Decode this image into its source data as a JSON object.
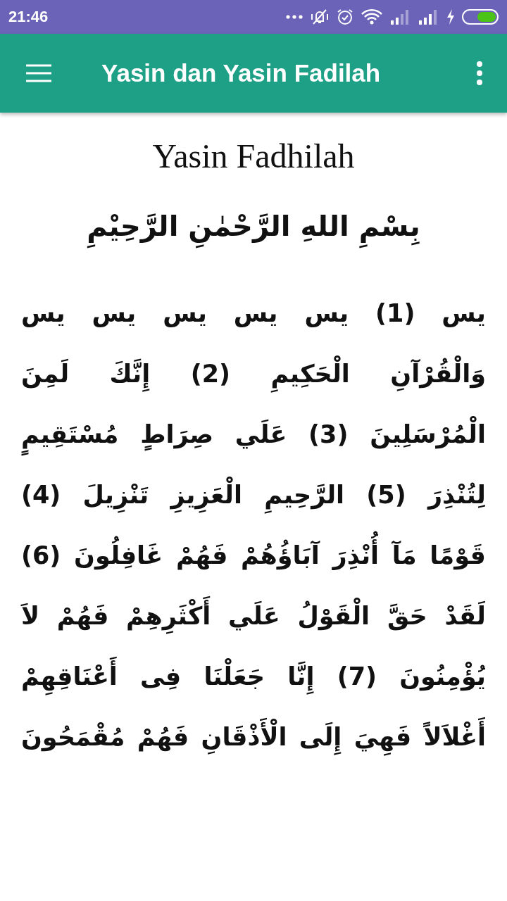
{
  "status_bar": {
    "time": "21:46"
  },
  "app_bar": {
    "title": "Yasin dan Yasin Fadilah"
  },
  "content": {
    "title": "Yasin Fadhilah",
    "basmalah": "بِسْمِ اللهِ الرَّحْمٰنِ الرَّحِيْمِ",
    "lines": [
      "يس (1) يس يس يس يس يس",
      "وَالْقُرْآنِ الْحَكِيمِ (2) إِنَّكَ لَمِنَ",
      "الْمُرْسَلِينَ (3) عَلَي صِرَاطٍ مُسْتَقِيمٍ",
      "لِتُنْذِرَ (5) الرَّحِيمِ الْعَزِيزِ تَنْزِيلَ (4)",
      "قَوْمًا مَآ أُنْذِرَ آبَاؤُهُمْ فَهُمْ غَافِلُونَ (6)",
      "لَقَدْ حَقَّ الْقَوْلُ عَلَي أَكْثَرِهِمْ فَهُمْ لاَ",
      "يُؤْمِنُونَ (7) إِنَّا جَعَلْنَا فِى أَعْنَاقِهِمْ",
      "أَغْلاَلاً فَهِيَ إِلَى الْأَذْقَانِ فَهُمْ مُقْمَحُونَ"
    ]
  }
}
